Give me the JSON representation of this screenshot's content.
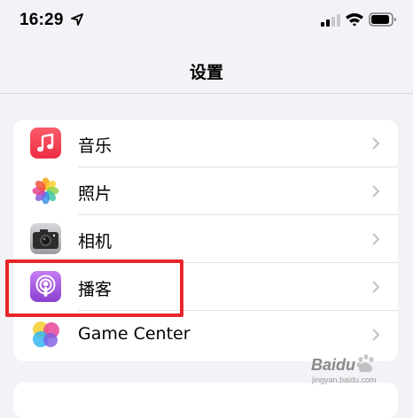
{
  "status_bar": {
    "time": "16:29",
    "icons": [
      "location-arrow-icon",
      "cellular-signal-icon",
      "wifi-icon",
      "battery-icon"
    ]
  },
  "nav": {
    "title": "设置"
  },
  "settings": {
    "rows": [
      {
        "label": "音乐",
        "icon": "music-app-icon",
        "icon_color": "#f2404f"
      },
      {
        "label": "照片",
        "icon": "photos-app-icon",
        "icon_color": "#ffffff"
      },
      {
        "label": "相机",
        "icon": "camera-app-icon",
        "icon_color": "#3a3a3c"
      },
      {
        "label": "播客",
        "icon": "podcasts-app-icon",
        "icon_color": "#a55ae6"
      },
      {
        "label": "Game Center",
        "icon": "game-center-app-icon",
        "icon_color": "#ffffff"
      }
    ]
  },
  "annotation": {
    "highlight_color": "#e8262b"
  },
  "watermark": {
    "logo": "Baidu",
    "sub": "jingyan.baidu.com"
  }
}
